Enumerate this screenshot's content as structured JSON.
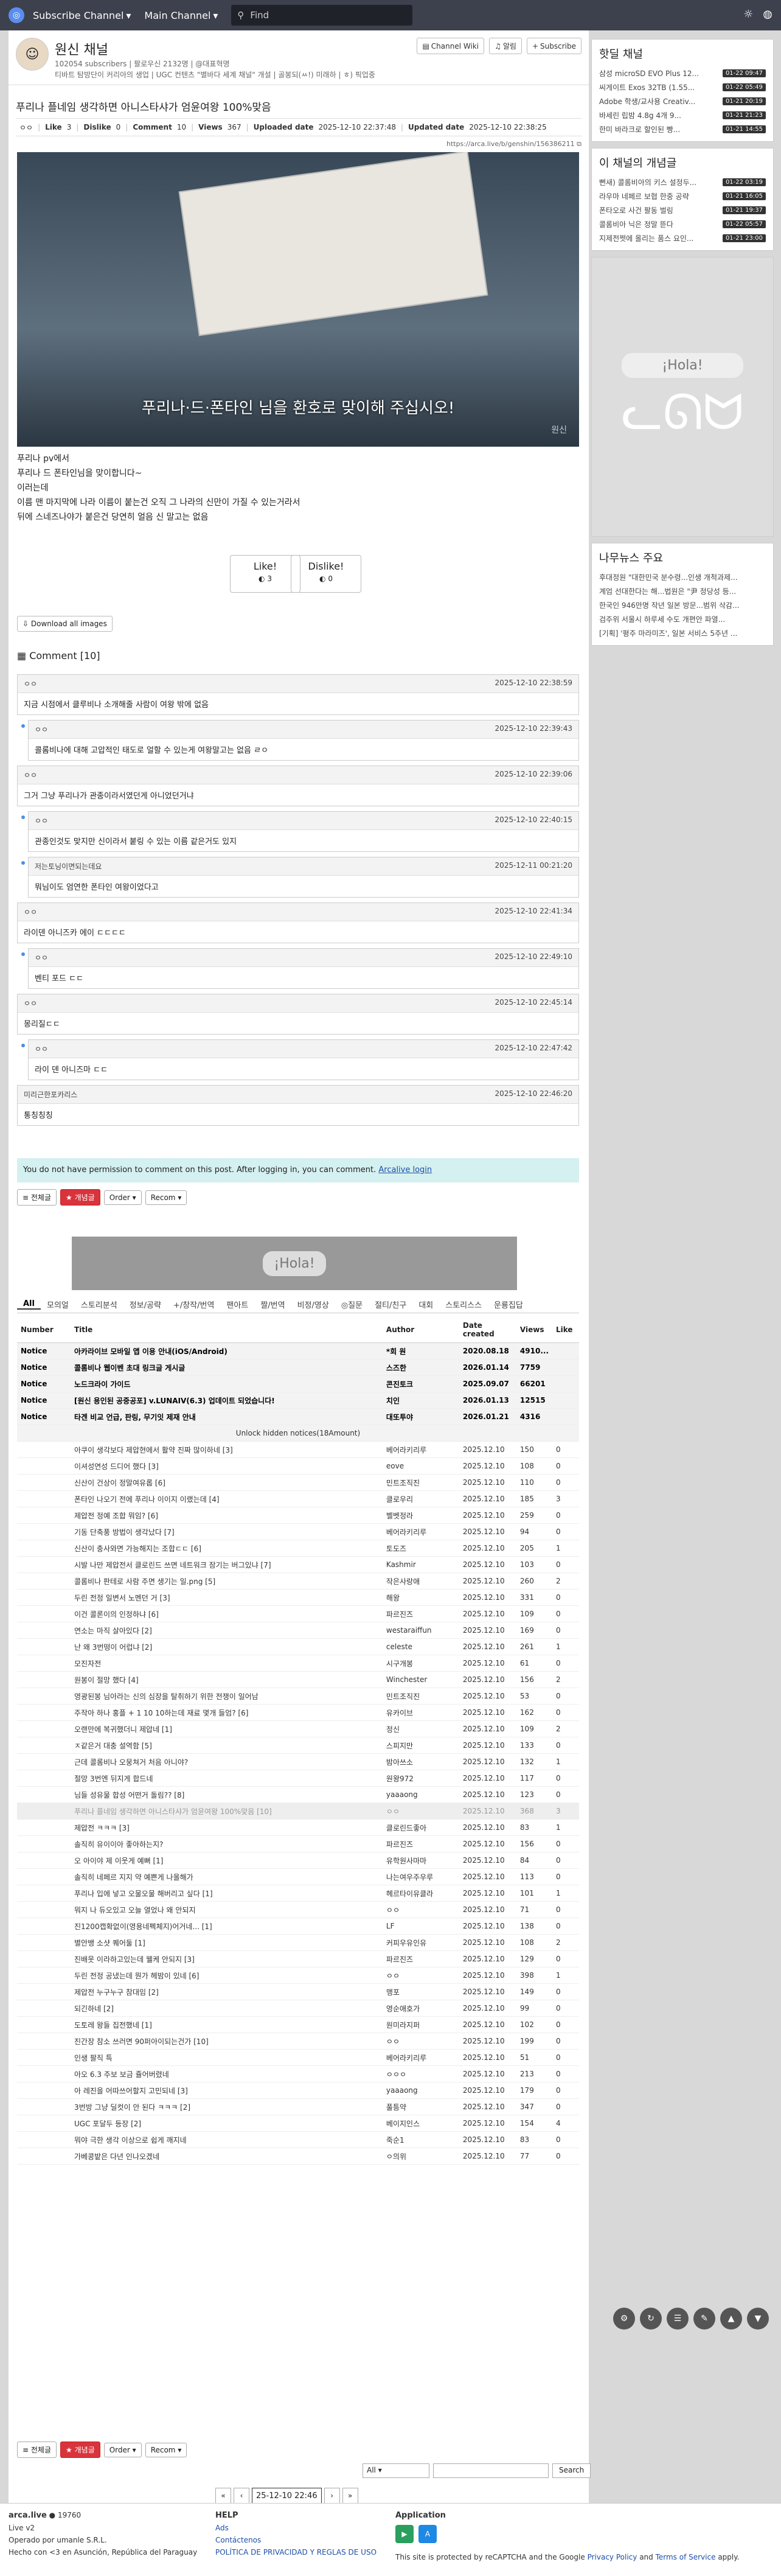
{
  "topbar": {
    "channel_dd": "Subscribe Channel",
    "main_dd": "Main Channel",
    "search_placeholder": "Find"
  },
  "channel": {
    "name": "원신 채널",
    "info": "102054 subscribers | 팔로우신 2132명 | @대표혁명",
    "desc": "티바트 탐방단이 커리아의 생업 | UGC 컨텐츠 \"별바다 세계 채널\" 개설 | 골봉되(ㅆ!) 미래하 | ㅎ) 픽업중",
    "wiki": "Channel Wiki",
    "notify": "알림",
    "subscribe": "Subscribe"
  },
  "post": {
    "title": "푸리나 플네임 생각하면 아니스타샤가 엄윤여왕 100%맞음",
    "author": "ㅇㅇ",
    "like_label": "Like",
    "like": "3",
    "dislike_label": "Dislike",
    "dislike": "0",
    "comment_label": "Comment",
    "comments": "10",
    "views_label": "Views",
    "views": "367",
    "uploaded_label": "Uploaded date",
    "uploaded": "2025-12-10 22:37:48",
    "updated_label": "Updated date",
    "updated": "2025-12-10 22:38:25",
    "link": "https://arca.live/b/genshin/156386211",
    "subtitle": "푸리나·드·폰타인 님을 환호로 맞이해 주십시오!",
    "watermark": "원신",
    "body": [
      "푸리나 pv에서",
      "푸리나 드 폰타인님을 맞이합니다~",
      "이러는데",
      "이름 맨 마지막에 나라 이름이 붙는건 오직 그 나라의 신만이 가질 수 있는거라서",
      "뒤에 스네즈나야가 붙은건 당연히 얼음 신 말고는 없음"
    ],
    "like_btn": "Like!",
    "like_count": "3",
    "dislike_btn": "Dislike!",
    "dislike_count": "0",
    "download": "Download all images"
  },
  "comments_title": "Comment [10]",
  "comments": [
    {
      "user": "ㅇㅇ",
      "time": "2025-12-10 22:38:59",
      "text": "지금 시점에서 클루비나 소개해줄 사람이 여왕 밖에 없음",
      "reply": false
    },
    {
      "user": "ㅇㅇ",
      "time": "2025-12-10 22:39:43",
      "text": "콜롬비나에 대해 고압적인 태도로 얼할 수 있는게 여왕말고는 없음 ㄹㅇ",
      "reply": true
    },
    {
      "user": "ㅇㅇ",
      "time": "2025-12-10 22:39:06",
      "text": "그거 그냥 푸리나가 관종이라서였던게 아니었던거냐",
      "reply": false
    },
    {
      "user": "ㅇㅇ",
      "time": "2025-12-10 22:40:15",
      "text": "관종인것도 맞지만 신이라서 붙링 수 있는 이름 같은거도 있지",
      "reply": true
    },
    {
      "user": "저는토닝이면되는데요",
      "time": "2025-12-11 00:21:20",
      "text": "뭐님이도 엄연한 폰타인 여왕이었다고",
      "reply": true
    },
    {
      "user": "ㅇㅇ",
      "time": "2025-12-10 22:41:34",
      "text": "라이덴 아니즈카 에이 ㄷㄷㄷㄷ",
      "reply": false
    },
    {
      "user": "ㅇㅇ",
      "time": "2025-12-10 22:49:10",
      "text": "벤티 포드 ㄷㄷ",
      "reply": true
    },
    {
      "user": "ㅇㅇ",
      "time": "2025-12-10 22:45:14",
      "text": "몽리질ㄷㄷ",
      "reply": false
    },
    {
      "user": "ㅇㅇ",
      "time": "2025-12-10 22:47:42",
      "text": "라이 덴 아니즈마 ㄷㄷ",
      "reply": true
    },
    {
      "user": "미리근한포카리스",
      "time": "2025-12-10 22:46:20",
      "text": "통칭칭칭",
      "reply": false
    }
  ],
  "notice": {
    "text": "You do not have permission to comment on this post. After logging in, you can comment.",
    "link": "Arcalive login"
  },
  "controls": {
    "all": "전체글",
    "best": "개념글",
    "order": "Order",
    "recom": "Recom"
  },
  "banner": "¡Hola!",
  "categories": [
    "All",
    "모의얼",
    "스토리분석",
    "정보/공략",
    "+/창작/번역",
    "팬아트",
    "짤/번역",
    "비정/영상",
    "◎질문",
    "절티/친구",
    "대회",
    "스토리스스",
    "운룡집답"
  ],
  "table_headers": {
    "num": "Number",
    "title": "Title",
    "author": "Author",
    "date": "Date created",
    "views": "Views",
    "like": "Like"
  },
  "notices": [
    {
      "num": "Notice",
      "title": "아카라이브 모바일 앱 이용 안내(iOS/Android)",
      "author": "*회 원",
      "date": "2020.08.18",
      "views": "4910...",
      "like": ""
    },
    {
      "num": "Notice",
      "title": "콜롬비나 웹이벤 초대 링크글 게시글",
      "author": "스즈한",
      "date": "2026.01.14",
      "views": "7759",
      "like": ""
    },
    {
      "num": "Notice",
      "title": "노드크라이 가이드",
      "author": "콘진토크",
      "date": "2025.09.07",
      "views": "66201",
      "like": ""
    },
    {
      "num": "Notice",
      "title": "[원신 용인된 공중공포] v.LUNAIV(6.3) 업데이트 되었습니다!",
      "author": "치인",
      "date": "2026.01.13",
      "views": "12515",
      "like": ""
    },
    {
      "num": "Notice",
      "title": "타겐 비교 언급, 판링, 무기잇 제재 안내",
      "author": "대또투야",
      "date": "2026.01.21",
      "views": "4316",
      "like": ""
    }
  ],
  "hidden_notices": "Unlock hidden notices(18Amount)",
  "rows": [
    {
      "title": "아쿠이 생각보다 제압현에서 활약 진짜 많이하네 [3]",
      "author": "베어라키리루",
      "date": "2025.12.10",
      "views": "150",
      "like": "0"
    },
    {
      "title": "이셔성연성 드디어 했다 [3]",
      "author": "eove",
      "date": "2025.12.10",
      "views": "108",
      "like": "0"
    },
    {
      "title": "신산이 건상이 정말여유롭 [6]",
      "author": "민트조직진",
      "date": "2025.12.10",
      "views": "110",
      "like": "0"
    },
    {
      "title": "폰타인 나오기 전에 푸리나 이이지 이랬는데 [4]",
      "author": "클로우리",
      "date": "2025.12.10",
      "views": "185",
      "like": "3"
    },
    {
      "title": "제압전 정예 조합 뭐임? [6]",
      "author": "벨벳정라",
      "date": "2025.12.10",
      "views": "259",
      "like": "0"
    },
    {
      "title": "기동 단축풍 방법이 생각났다 [7]",
      "author": "베어라키리루",
      "date": "2025.12.10",
      "views": "94",
      "like": "0"
    },
    {
      "title": "신산이 충사와면 가능해지는 조합ㄷㄷ [6]",
      "author": "토도즈",
      "date": "2025.12.10",
      "views": "205",
      "like": "1"
    },
    {
      "title": "시발 나만 제압전서 클로린드 쓰면 네트워크 잠기는 버그있냐 [7]",
      "author": "Kashmir",
      "date": "2025.12.10",
      "views": "103",
      "like": "0"
    },
    {
      "title": "콜롬비나 판테로 사람 주면 생기는 일.png [5]",
      "author": "작은사랑애",
      "date": "2025.12.10",
      "views": "260",
      "like": "2"
    },
    {
      "title": "두린 전정 일변서 노멘던 거 [3]",
      "author": "해왕",
      "date": "2025.12.10",
      "views": "331",
      "like": "0"
    },
    {
      "title": "이건 콜론이의 인정하냐 [6]",
      "author": "파르진즈",
      "date": "2025.12.10",
      "views": "109",
      "like": "0"
    },
    {
      "title": "연소는 마직 살아있다 [2]",
      "author": "westaraiffun",
      "date": "2025.12.10",
      "views": "169",
      "like": "0"
    },
    {
      "title": "난 왜 3번떵이 어럽냐 [2]",
      "author": "celeste",
      "date": "2025.12.10",
      "views": "261",
      "like": "1"
    },
    {
      "title": "모진자전",
      "author": "시구개봉",
      "date": "2025.12.10",
      "views": "61",
      "like": "0"
    },
    {
      "title": "원봉이 절망 했다 [4]",
      "author": "Winchester",
      "date": "2025.12.10",
      "views": "156",
      "like": "2"
    },
    {
      "title": "영광된봉 님아라는 신의 심장을 탈취하기 위한 전쟁이 일어남",
      "author": "민트조직진",
      "date": "2025.12.10",
      "views": "53",
      "like": "0"
    },
    {
      "title": "주작아 하나 홍플 + 1 10 10하는데 재료 몇개 들엄? [6]",
      "author": "유카이브",
      "date": "2025.12.10",
      "views": "162",
      "like": "0"
    },
    {
      "title": "오랜만에 복귀했더니 제압네 [1]",
      "author": "정신",
      "date": "2025.12.10",
      "views": "109",
      "like": "2"
    },
    {
      "title": "ㅈ같은거 대충 설역함 [5]",
      "author": "스피지만",
      "date": "2025.12.10",
      "views": "133",
      "like": "0"
    },
    {
      "title": "근데 콜롬비나 오뭉쳐거 처음 아니야?",
      "author": "밤아쓰소",
      "date": "2025.12.10",
      "views": "132",
      "like": "1"
    },
    {
      "title": "절망 3번엔 뒤지게 합드네",
      "author": "원왕972",
      "date": "2025.12.10",
      "views": "117",
      "like": "0"
    },
    {
      "title": "님들 성유물 합성 어떤거 돌림?? [8]",
      "author": "yaaaong",
      "date": "2025.12.10",
      "views": "123",
      "like": "0"
    },
    {
      "title": "푸리나 플네임 생각하면 아니스타샤가 엄윤여왕 100%맞음 [10]",
      "author": "ㅇㅇ",
      "date": "2025.12.10",
      "views": "368",
      "like": "3",
      "current": true
    },
    {
      "title": "제압전 ㅋㅋㅋ [3]",
      "author": "클로린드좋아",
      "date": "2025.12.10",
      "views": "83",
      "like": "1"
    },
    {
      "title": "솔직히 유이이아 좋아하는지?",
      "author": "파르진즈",
      "date": "2025.12.10",
      "views": "156",
      "like": "0"
    },
    {
      "title": "오 아이야 제 이웃게 예뻐 [1]",
      "author": "유학원사마마",
      "date": "2025.12.10",
      "views": "84",
      "like": "0"
    },
    {
      "title": "솔직히 네페르 지지 약 예쁜게 나올해가",
      "author": "나는여우주우루",
      "date": "2025.12.10",
      "views": "113",
      "like": "0"
    },
    {
      "title": "푸리나 입에 넣고 오물오물 해버리고 싶다 [1]",
      "author": "헤르타이유클라",
      "date": "2025.12.10",
      "views": "101",
      "like": "1"
    },
    {
      "title": "뭐지 나 듀오있고 오늘 열었나 왜 안되지",
      "author": "ㅇㅇ",
      "date": "2025.12.10",
      "views": "71",
      "like": "0"
    },
    {
      "title": "진1200캡확없이(영용네펙체지)어거네... [1]",
      "author": "LF",
      "date": "2025.12.10",
      "views": "138",
      "like": "0"
    },
    {
      "title": "별안뱅 소샷 퀘어둘 [1]",
      "author": "커피우유인유",
      "date": "2025.12.10",
      "views": "108",
      "like": "2"
    },
    {
      "title": "진배웃 이라하고있는데 웰케 안되지 [3]",
      "author": "파르진즈",
      "date": "2025.12.10",
      "views": "129",
      "like": "0"
    },
    {
      "title": "두린 전정 공냈는데 뭔가 헤밤이 있네 [6]",
      "author": "ㅇㅇ",
      "date": "2025.12.10",
      "views": "398",
      "like": "1"
    },
    {
      "title": "제압전 누구누구 참대임 [2]",
      "author": "맹포",
      "date": "2025.12.10",
      "views": "149",
      "like": "0"
    },
    {
      "title": "되긴하네 [2]",
      "author": "영순애호가",
      "date": "2025.12.10",
      "views": "99",
      "like": "0"
    },
    {
      "title": "도토레 왕들 집전했네 [1]",
      "author": "원미라지퍼",
      "date": "2025.12.10",
      "views": "102",
      "like": "0"
    },
    {
      "title": "진간장 참소 쓰러면 90퍼아이되는건가 [10]",
      "author": "ㅇㅇ",
      "date": "2025.12.10",
      "views": "199",
      "like": "0"
    },
    {
      "title": "인생 팔직 특",
      "author": "베어라키리루",
      "date": "2025.12.10",
      "views": "51",
      "like": "0"
    },
    {
      "title": "아오 6.3 주보 보금 쥴어버렸네",
      "author": "ㅇㅇㅇ",
      "date": "2025.12.10",
      "views": "213",
      "like": "0"
    },
    {
      "title": "아 레진을 어따쓰어할지 고민되네 [3]",
      "author": "yaaaong",
      "date": "2025.12.10",
      "views": "179",
      "like": "0"
    },
    {
      "title": "3번방 그냥 딜컷이 안 된다 ㅋㅋㅋ [2]",
      "author": "풀틍약",
      "date": "2025.12.10",
      "views": "347",
      "like": "0"
    },
    {
      "title": "UGC 포달두 등장 [2]",
      "author": "베이지인스",
      "date": "2025.12.10",
      "views": "154",
      "like": "4"
    },
    {
      "title": "뭐야 극한 생각 이상으로 쉽게 깨지네",
      "author": "죽순1",
      "date": "2025.12.10",
      "views": "83",
      "like": "0"
    },
    {
      "title": "가베콩밭은 다년 인나오겠네",
      "author": "ㅇ의위",
      "date": "2025.12.10",
      "views": "77",
      "like": "0"
    }
  ],
  "search": {
    "select": "All",
    "button": "Search"
  },
  "pager": {
    "current": "25-12-10 22:46"
  },
  "sidebar": {
    "hot_title": "핫딜 채널",
    "hot": [
      {
        "title": "삼성 microSD EVO Plus 12...",
        "time": "01-22 09:47"
      },
      {
        "title": "씨게이트 Exos 32TB (1.55...",
        "time": "01-22 05:49"
      },
      {
        "title": "Adobe 학생/교사용 Creativ...",
        "time": "01-21 20:19"
      },
      {
        "title": "바세린 립밤 4.8g 4개 9...",
        "time": "01-21 21:23"
      },
      {
        "title": "한미 바라크로 할인된 빵... ",
        "time": "01-21 14:55"
      }
    ],
    "best_title": "이 채널의 개념글",
    "best": [
      {
        "title": "뻔새) 콜롬비아의 키스 설정두...",
        "time": "01-22 03:19"
      },
      {
        "title": "라우마 네페르 보협 한중 공략",
        "time": "01-21 16:05"
      },
      {
        "title": "폰타오로 사건 팔동 벌링",
        "time": "01-21 19:37"
      },
      {
        "title": "콜롬비아 닉은 정말 뜯다",
        "time": "01-22 05:57"
      },
      {
        "title": "지제전쩟에 올리는 품스 요인...",
        "time": "01-21 23:00"
      }
    ],
    "hola": "¡Hola!",
    "news_title": "나무뉴스 주요",
    "news": [
      "후대정원 \"대한민국 분수령...인생 개척과제...",
      "계엄 선대한다는 해...법원은 \"尹 정당성 등...",
      "한국인 946만명 작년 일본 방문...범위 삭감...",
      "검주위 서울시 하루세 수도 개편안 파열...",
      "[기획] '평주 마라미즈', 일본 서비스 5주년 ..."
    ]
  },
  "footer": {
    "site": "arca.live",
    "live_count": "19760",
    "version": "Live v2",
    "company": "Operado por umanle S.R.L.",
    "made": "Hecho con <3 en Asunción, República del Paraguay",
    "help_title": "HELP",
    "help": [
      "Ads",
      "Contáctenos",
      "POLÍTICA DE PRIVACIDAD Y REGLAS DE USO"
    ],
    "app_title": "Application",
    "recaptcha_pre": "This site is protected by reCAPTCHA and the Google",
    "privacy": "Privacy Policy",
    "and": "and",
    "terms": "Terms of Service",
    "apply": "apply."
  }
}
